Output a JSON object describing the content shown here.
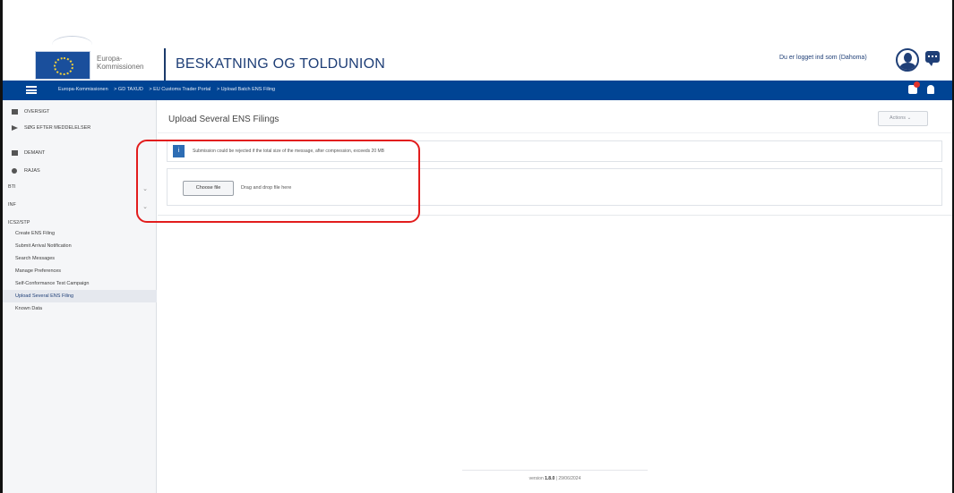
{
  "header": {
    "logo_line1": "Europa-",
    "logo_line2": "Kommissionen",
    "site_title": "BESKATNING OG TOLDUNION",
    "login_text": "Du er logget ind som (Dahoma)"
  },
  "navbar": {
    "breadcrumbs": [
      "Europa-Kommissionen",
      "> GD TAXUD",
      "> EU Customs Trader Portal",
      "> Upload Batch ENS Filing"
    ]
  },
  "sidebar": {
    "items": [
      {
        "label": "OVERSIGT"
      },
      {
        "label": "SØG EFTER MEDDELELSER"
      },
      {
        "label": "DEMANT"
      },
      {
        "label": "RAJAS"
      },
      {
        "label": "BTI"
      },
      {
        "label": "INF"
      }
    ],
    "section_label": "ICS2/STP",
    "sub_items": [
      {
        "label": "Create ENS Filing"
      },
      {
        "label": "Submit Arrival Notification"
      },
      {
        "label": "Search Messages"
      },
      {
        "label": "Manage Preferences"
      },
      {
        "label": "Self-Conformance Test Campaign"
      },
      {
        "label": "Upload Several ENS Filing"
      },
      {
        "label": "Known Data"
      }
    ]
  },
  "main": {
    "page_title": "Upload Several ENS Filings",
    "actions_label": "Actions",
    "info_text": "Submission could be rejected if the total size of the message, after compression, exceeds 20 MB",
    "choose_file_label": "Choose file",
    "drag_text": "Drag and drop file here",
    "footer_version_label": "version",
    "footer_version": "1.8.0",
    "footer_date": "29/06/2024"
  },
  "colors": {
    "navbar": "#004494",
    "title": "#1f3f77",
    "highlight": "#e21d1d"
  }
}
